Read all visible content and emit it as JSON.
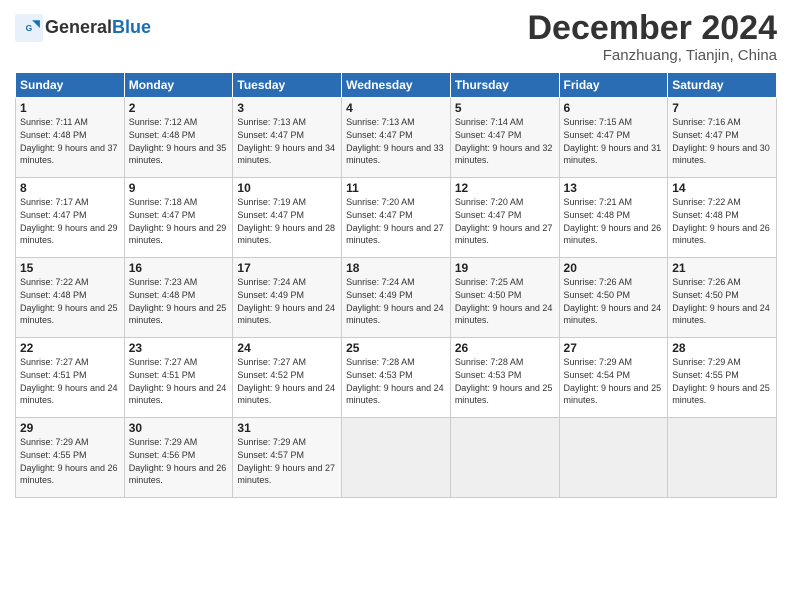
{
  "logo": {
    "line1": "General",
    "line2": "Blue"
  },
  "title": "December 2024",
  "subtitle": "Fanzhuang, Tianjin, China",
  "days_of_week": [
    "Sunday",
    "Monday",
    "Tuesday",
    "Wednesday",
    "Thursday",
    "Friday",
    "Saturday"
  ],
  "weeks": [
    [
      {
        "num": "1",
        "rise": "7:11 AM",
        "set": "4:48 PM",
        "daylight": "9 hours and 37 minutes."
      },
      {
        "num": "2",
        "rise": "7:12 AM",
        "set": "4:48 PM",
        "daylight": "9 hours and 35 minutes."
      },
      {
        "num": "3",
        "rise": "7:13 AM",
        "set": "4:47 PM",
        "daylight": "9 hours and 34 minutes."
      },
      {
        "num": "4",
        "rise": "7:13 AM",
        "set": "4:47 PM",
        "daylight": "9 hours and 33 minutes."
      },
      {
        "num": "5",
        "rise": "7:14 AM",
        "set": "4:47 PM",
        "daylight": "9 hours and 32 minutes."
      },
      {
        "num": "6",
        "rise": "7:15 AM",
        "set": "4:47 PM",
        "daylight": "9 hours and 31 minutes."
      },
      {
        "num": "7",
        "rise": "7:16 AM",
        "set": "4:47 PM",
        "daylight": "9 hours and 30 minutes."
      }
    ],
    [
      {
        "num": "8",
        "rise": "7:17 AM",
        "set": "4:47 PM",
        "daylight": "9 hours and 29 minutes."
      },
      {
        "num": "9",
        "rise": "7:18 AM",
        "set": "4:47 PM",
        "daylight": "9 hours and 29 minutes."
      },
      {
        "num": "10",
        "rise": "7:19 AM",
        "set": "4:47 PM",
        "daylight": "9 hours and 28 minutes."
      },
      {
        "num": "11",
        "rise": "7:20 AM",
        "set": "4:47 PM",
        "daylight": "9 hours and 27 minutes."
      },
      {
        "num": "12",
        "rise": "7:20 AM",
        "set": "4:47 PM",
        "daylight": "9 hours and 27 minutes."
      },
      {
        "num": "13",
        "rise": "7:21 AM",
        "set": "4:48 PM",
        "daylight": "9 hours and 26 minutes."
      },
      {
        "num": "14",
        "rise": "7:22 AM",
        "set": "4:48 PM",
        "daylight": "9 hours and 26 minutes."
      }
    ],
    [
      {
        "num": "15",
        "rise": "7:22 AM",
        "set": "4:48 PM",
        "daylight": "9 hours and 25 minutes."
      },
      {
        "num": "16",
        "rise": "7:23 AM",
        "set": "4:48 PM",
        "daylight": "9 hours and 25 minutes."
      },
      {
        "num": "17",
        "rise": "7:24 AM",
        "set": "4:49 PM",
        "daylight": "9 hours and 24 minutes."
      },
      {
        "num": "18",
        "rise": "7:24 AM",
        "set": "4:49 PM",
        "daylight": "9 hours and 24 minutes."
      },
      {
        "num": "19",
        "rise": "7:25 AM",
        "set": "4:50 PM",
        "daylight": "9 hours and 24 minutes."
      },
      {
        "num": "20",
        "rise": "7:26 AM",
        "set": "4:50 PM",
        "daylight": "9 hours and 24 minutes."
      },
      {
        "num": "21",
        "rise": "7:26 AM",
        "set": "4:50 PM",
        "daylight": "9 hours and 24 minutes."
      }
    ],
    [
      {
        "num": "22",
        "rise": "7:27 AM",
        "set": "4:51 PM",
        "daylight": "9 hours and 24 minutes."
      },
      {
        "num": "23",
        "rise": "7:27 AM",
        "set": "4:51 PM",
        "daylight": "9 hours and 24 minutes."
      },
      {
        "num": "24",
        "rise": "7:27 AM",
        "set": "4:52 PM",
        "daylight": "9 hours and 24 minutes."
      },
      {
        "num": "25",
        "rise": "7:28 AM",
        "set": "4:53 PM",
        "daylight": "9 hours and 24 minutes."
      },
      {
        "num": "26",
        "rise": "7:28 AM",
        "set": "4:53 PM",
        "daylight": "9 hours and 25 minutes."
      },
      {
        "num": "27",
        "rise": "7:29 AM",
        "set": "4:54 PM",
        "daylight": "9 hours and 25 minutes."
      },
      {
        "num": "28",
        "rise": "7:29 AM",
        "set": "4:55 PM",
        "daylight": "9 hours and 25 minutes."
      }
    ],
    [
      {
        "num": "29",
        "rise": "7:29 AM",
        "set": "4:55 PM",
        "daylight": "9 hours and 26 minutes."
      },
      {
        "num": "30",
        "rise": "7:29 AM",
        "set": "4:56 PM",
        "daylight": "9 hours and 26 minutes."
      },
      {
        "num": "31",
        "rise": "7:29 AM",
        "set": "4:57 PM",
        "daylight": "9 hours and 27 minutes."
      },
      null,
      null,
      null,
      null
    ]
  ]
}
